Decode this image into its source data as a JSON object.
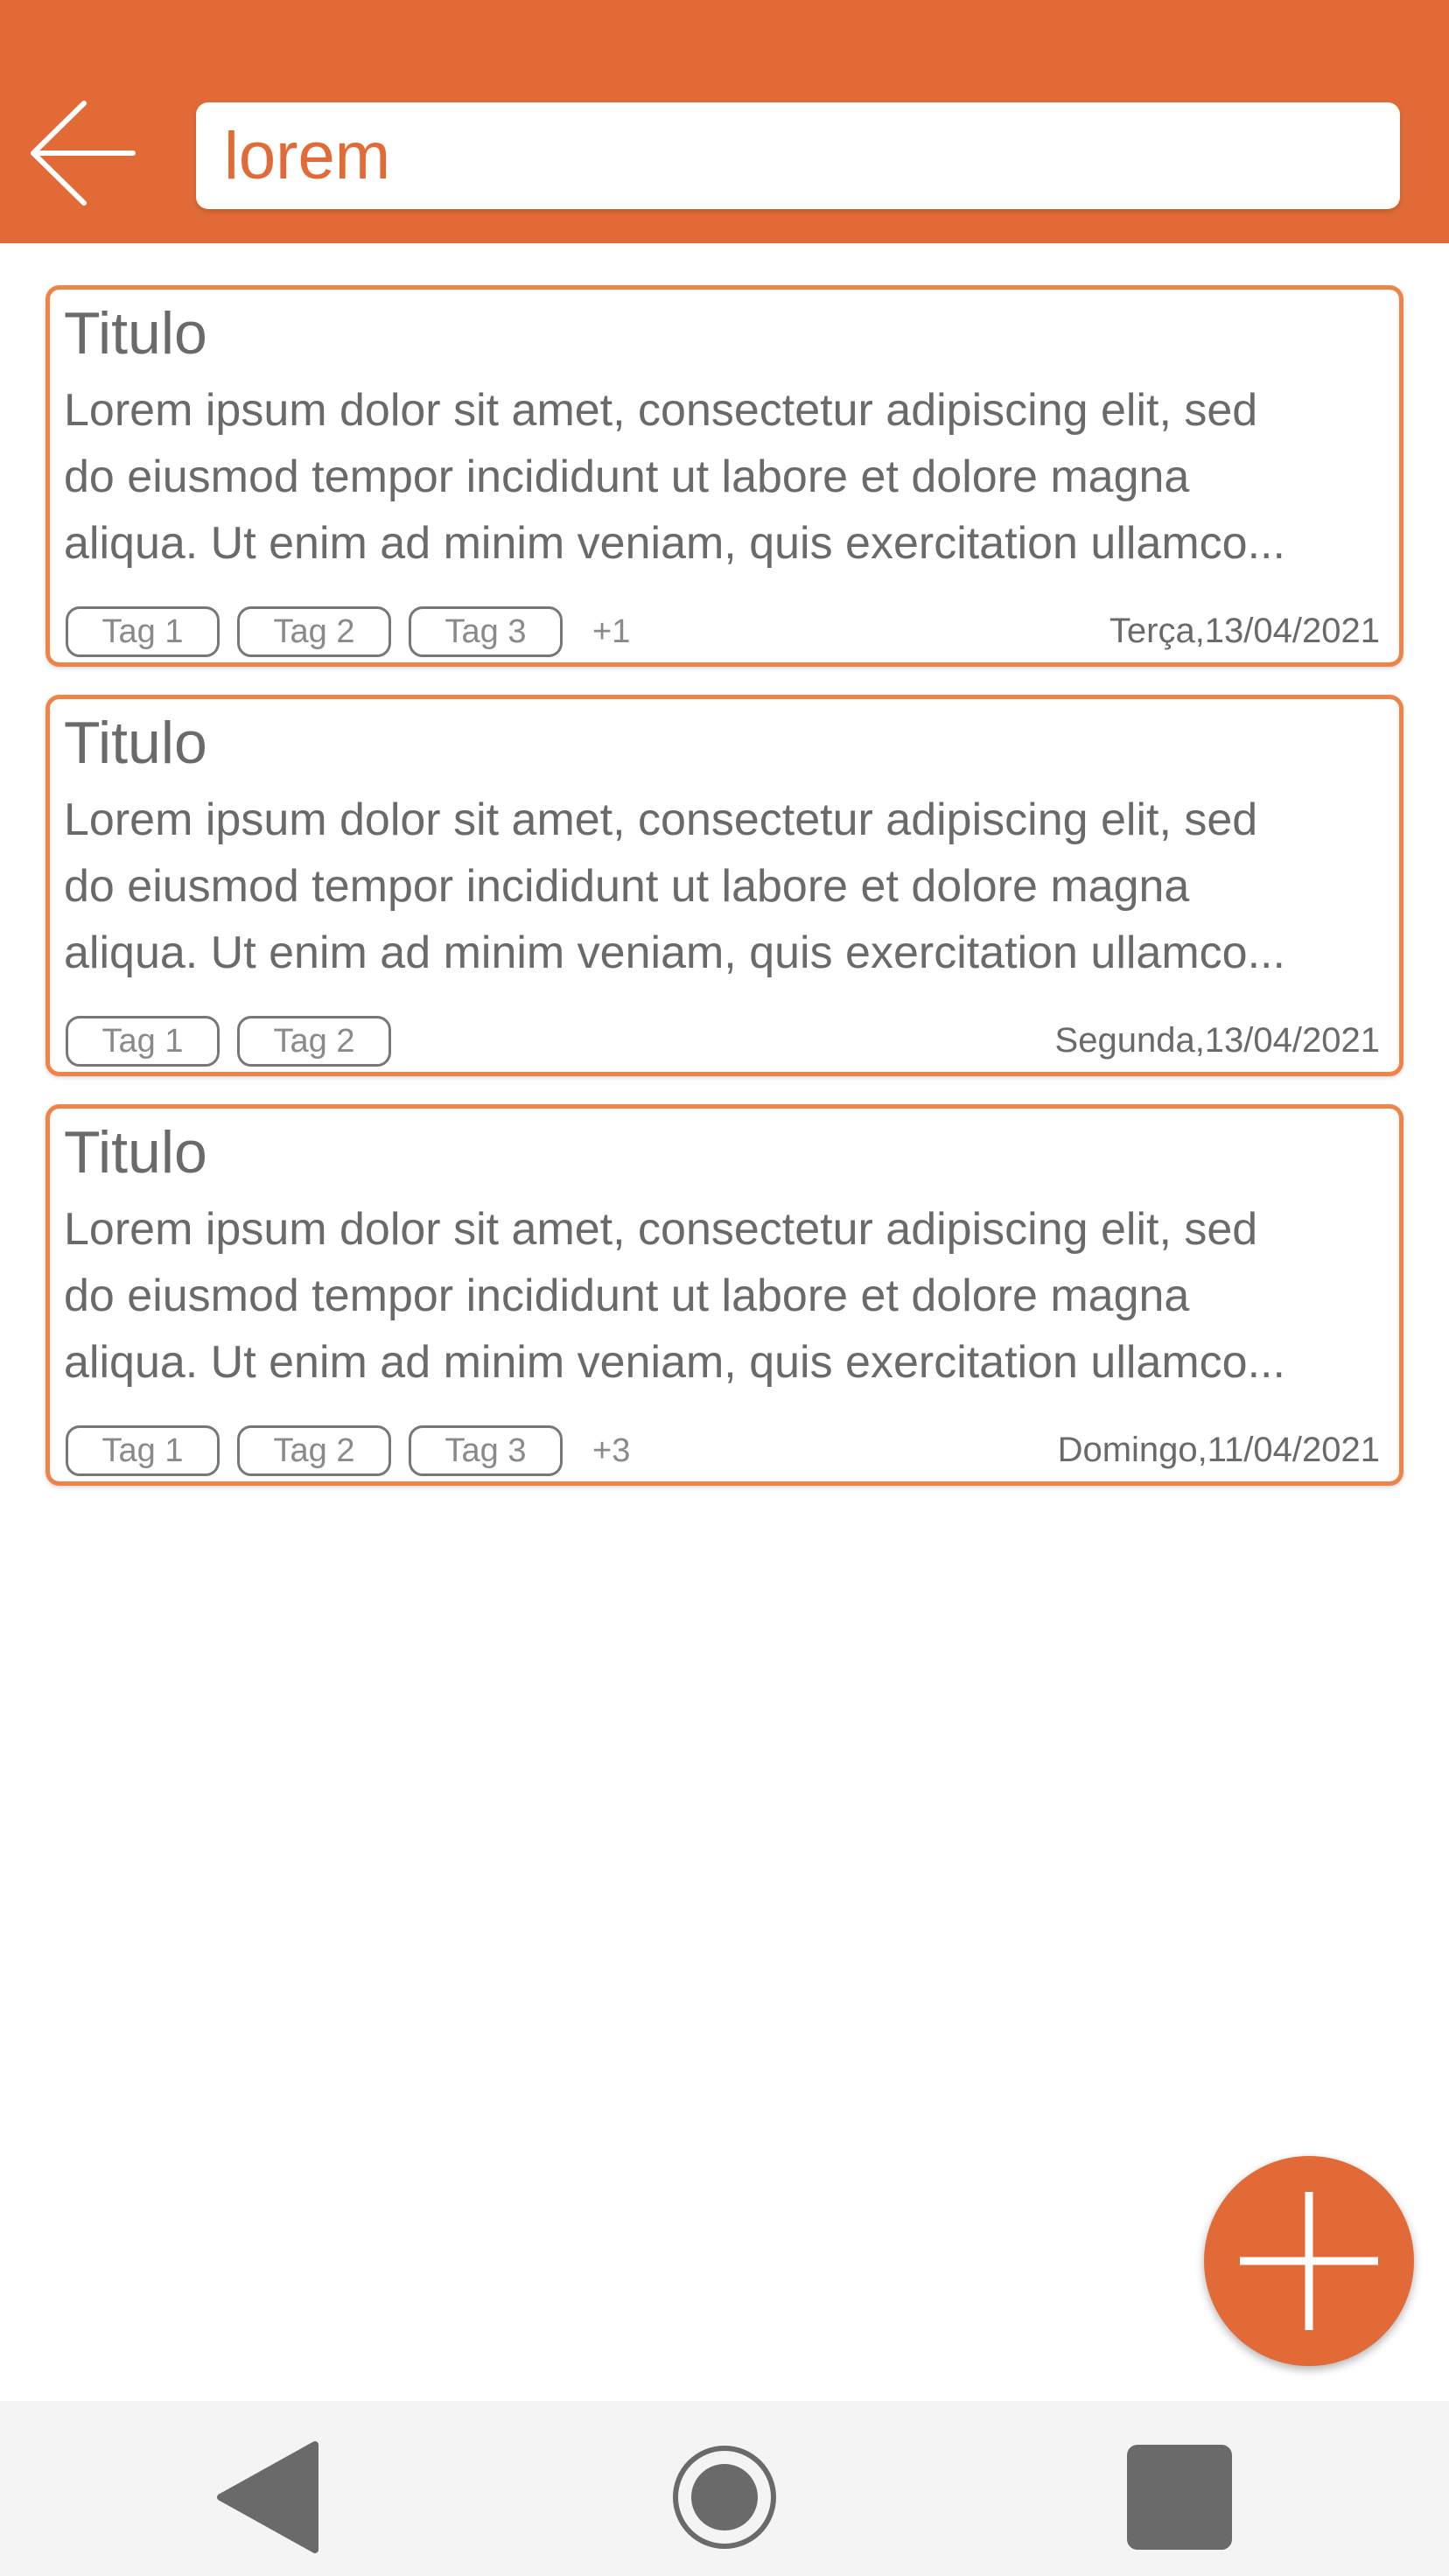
{
  "header": {
    "back_icon": "arrow-left-icon",
    "search": {
      "value": "lorem",
      "placeholder": ""
    }
  },
  "notes": [
    {
      "title": "Titulo",
      "body": [
        "Lorem ipsum dolor sit amet, consectetur adipiscing elit, sed",
        "do eiusmod tempor incididunt ut labore et dolore magna",
        "aliqua. Ut enim ad minim veniam, quis exercitation ullamco..."
      ],
      "tags": [
        "Tag 1",
        "Tag 2",
        "Tag 3"
      ],
      "more": "+1",
      "date": "Terça,13/04/2021"
    },
    {
      "title": "Titulo",
      "body": [
        "Lorem ipsum dolor sit amet, consectetur adipiscing elit, sed",
        "do eiusmod tempor incididunt ut labore et dolore magna",
        "aliqua. Ut enim ad minim veniam, quis exercitation ullamco..."
      ],
      "tags": [
        "Tag 1",
        "Tag 2"
      ],
      "more": "",
      "date": "Segunda,13/04/2021"
    },
    {
      "title": "Titulo",
      "body": [
        "Lorem ipsum dolor sit amet, consectetur adipiscing elit, sed",
        "do eiusmod tempor incididunt ut labore et dolore magna",
        "aliqua. Ut enim ad minim veniam, quis exercitation ullamco..."
      ],
      "tags": [
        "Tag 1",
        "Tag 2",
        "Tag 3"
      ],
      "more": "+3",
      "date": "Domingo,11/04/2021"
    }
  ],
  "fab": {
    "icon": "plus-icon"
  },
  "nav": {
    "back_icon": "nav-back-triangle-icon",
    "home_icon": "nav-home-circle-icon",
    "recents_icon": "nav-recents-square-icon"
  },
  "colors": {
    "accent": "#E26A37",
    "card_border": "#F08448",
    "text": "#6a6a6a"
  }
}
